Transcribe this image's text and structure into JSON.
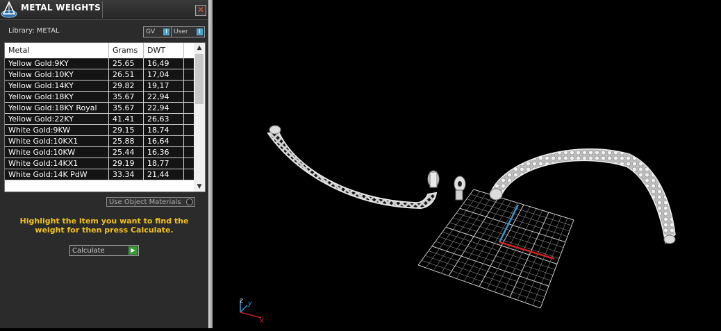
{
  "panel": {
    "title": "METAL WEIGHTS",
    "close_label": "✕",
    "library_label": "Library: METAL",
    "toggles": [
      {
        "label": "GV",
        "knob": "I"
      },
      {
        "label": "User",
        "knob": "I"
      }
    ],
    "table": {
      "headers": [
        "Metal",
        "Grams",
        "DWT"
      ],
      "rows": [
        [
          "Yellow Gold:9KY",
          "25.65",
          "16,49"
        ],
        [
          "Yellow Gold:10KY",
          "26.51",
          "17,04"
        ],
        [
          "Yellow Gold:14KY",
          "29.82",
          "19,17"
        ],
        [
          "Yellow Gold:18KY",
          "35.67",
          "22,94"
        ],
        [
          "Yellow Gold:18KY Royal",
          "35.67",
          "22,94"
        ],
        [
          "Yellow Gold:22KY",
          "41.41",
          "26,63"
        ],
        [
          "White Gold:9KW",
          "29.15",
          "18,74"
        ],
        [
          "White Gold:10KX1",
          "25.88",
          "16,64"
        ],
        [
          "White Gold:10KW",
          "25.44",
          "16,36"
        ],
        [
          "White Gold:14KX1",
          "29.19",
          "18,77"
        ],
        [
          "White Gold:14K PdW",
          "33.34",
          "21,44"
        ]
      ]
    },
    "use_object_materials_label": "Use Object Materials",
    "hint": "Highlight the item you want to find the weight for then press Calculate.",
    "calculate_label": "Calculate"
  },
  "viewport": {
    "axis_labels": {
      "z": "z",
      "y": "y",
      "x": "x"
    }
  },
  "colors": {
    "panel_bg": "#2b2b2b",
    "hint_text": "#f0c020",
    "axis_y": "#3a9ad9",
    "axis_x": "#d02020",
    "grid": "#bdbdbd",
    "model": "#e6e6e6"
  }
}
